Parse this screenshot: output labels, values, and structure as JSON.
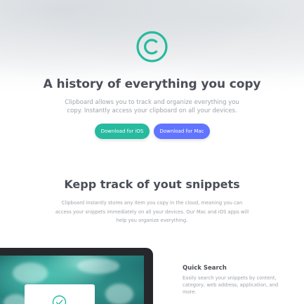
{
  "hero": {
    "title": "A history of everything you copy",
    "description": "Clipboard allows you to track and organize everything you copy. Instantly access your clipboard on all your devices.",
    "ios_button": "Download for iOS",
    "mac_button": "Download for Mac"
  },
  "snippets": {
    "title": "Kepp track of yout snippets",
    "description": "Clipboard instantly stores any item you copy in the cloud, meaning you can access your snippets immediately on all your devices. Our Mac and iOS apps will help you organize everything."
  },
  "features": [
    {
      "title": "Quick Search",
      "description": "Easily search your snippets by content, category, web address, application, and more."
    }
  ],
  "colors": {
    "accent_green": "#26ba9f",
    "accent_blue": "#6174ff",
    "heading": "#4c4f59",
    "body_text": "#a0a3ab"
  },
  "icons": {
    "logo": "copyright-logo-icon",
    "card": "checkmark-icon"
  }
}
